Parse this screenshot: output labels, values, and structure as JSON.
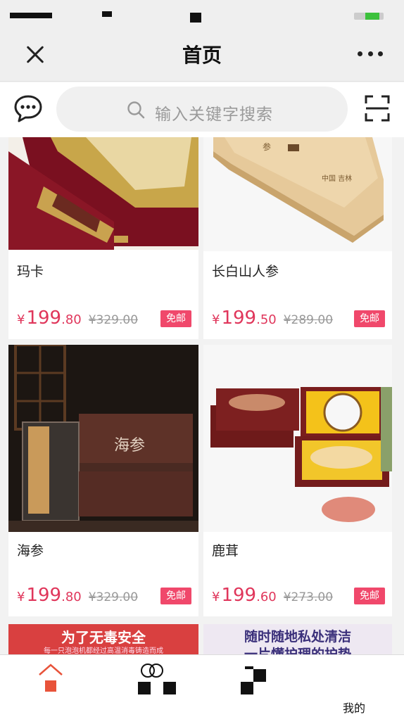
{
  "header": {
    "title": "首页"
  },
  "search": {
    "placeholder": "输入关键字搜索"
  },
  "products": [
    {
      "name": "玛卡",
      "currency": "¥",
      "price_int": "199",
      "price_dec": ".80",
      "original_price": "¥329.00",
      "badge": "免邮"
    },
    {
      "name": "长白山人参",
      "currency": "¥",
      "price_int": "199",
      "price_dec": ".50",
      "original_price": "¥289.00",
      "badge": "免邮"
    },
    {
      "name": "海参",
      "currency": "¥",
      "price_int": "199",
      "price_dec": ".80",
      "original_price": "¥329.00",
      "badge": "免邮"
    },
    {
      "name": "鹿茸",
      "currency": "¥",
      "price_int": "199",
      "price_dec": ".60",
      "original_price": "¥273.00",
      "badge": "免邮"
    }
  ],
  "banners": [
    {
      "title": "为了无毒安全",
      "subtitle": "每一只泡泡机都经过高温消毒铸造而成"
    },
    {
      "title": "随时随地私处清洁",
      "subtitle": "一片懂护理的护垫"
    }
  ],
  "tabbar": {
    "items": [
      {
        "label": "",
        "icon": "home-icon"
      },
      {
        "label": "",
        "icon": "category-icon"
      },
      {
        "label": "",
        "icon": "cart-icon"
      },
      {
        "label": "我的",
        "icon": "profile-icon"
      }
    ]
  },
  "colors": {
    "price": "#e0365b",
    "badge": "#f0486b",
    "home_icon": "#e8533a"
  }
}
